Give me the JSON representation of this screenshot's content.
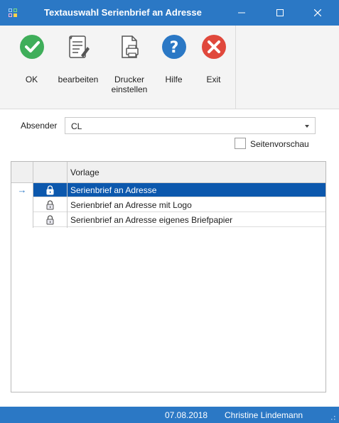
{
  "window": {
    "title": "Textauswahl Serienbrief an Adresse",
    "minimize_glyph": "—",
    "maximize_glyph": "☐",
    "close_glyph": "✕"
  },
  "toolbar": {
    "ok_label": "OK",
    "edit_label": "bearbeiten",
    "printer_label_line1": "Drucker",
    "printer_label_line2": "einstellen",
    "help_label": "Hilfe",
    "exit_label": "Exit"
  },
  "form": {
    "sender_label": "Absender",
    "sender_value": "CL",
    "preview_label": "Seitenvorschau",
    "preview_checked": false
  },
  "grid": {
    "column_header": "Vorlage",
    "rows": [
      {
        "label": "Serienbrief an Adresse",
        "selected": true,
        "icon": "lock-icon"
      },
      {
        "label": "Serienbrief an Adresse mit Logo",
        "selected": false,
        "icon": "lock-icon"
      },
      {
        "label": "Serienbrief an Adresse eigenes Briefpapier",
        "selected": false,
        "icon": "lock-icon"
      }
    ],
    "current_row_glyph": "→"
  },
  "status": {
    "date": "07.08.2018",
    "user": "Christine Lindemann"
  },
  "colors": {
    "accent": "#2b78c5",
    "selection": "#0c58ad",
    "ok_green": "#3fae5a",
    "help_blue": "#2b78c5",
    "exit_red": "#e0483c"
  }
}
